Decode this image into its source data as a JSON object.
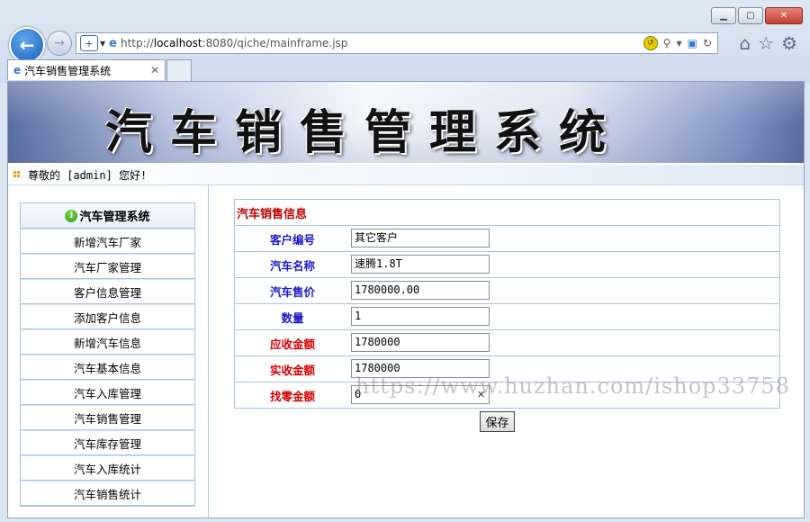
{
  "browser": {
    "url_prefix": "http://",
    "url_host": "localhost",
    "url_rest": ":8080/qiche/mainframe.jsp",
    "tab_title": "汽车销售管理系统"
  },
  "banner": {
    "title": "汽车销售管理系统"
  },
  "greeting": "尊敬的 [admin] 您好!",
  "sidebar": {
    "header": "汽车管理系统",
    "items": [
      {
        "label": "新增汽车厂家"
      },
      {
        "label": "汽车厂家管理"
      },
      {
        "label": "客户信息管理"
      },
      {
        "label": "添加客户信息"
      },
      {
        "label": "新增汽车信息"
      },
      {
        "label": "汽车基本信息"
      },
      {
        "label": "汽车入库管理"
      },
      {
        "label": "汽车销售管理"
      },
      {
        "label": "汽车库存管理"
      },
      {
        "label": "汽车入库统计"
      },
      {
        "label": "汽车销售统计"
      }
    ]
  },
  "form": {
    "title": "汽车销售信息",
    "fields": [
      {
        "label": "客户编号",
        "value": "其它客户"
      },
      {
        "label": "汽车名称",
        "value": "速腾1.8T"
      },
      {
        "label": "汽车售价",
        "value": "1780000.00"
      },
      {
        "label": "数量",
        "value": "1"
      },
      {
        "label": "应收金额",
        "value": "1780000"
      },
      {
        "label": "实收金额",
        "value": "1780000"
      },
      {
        "label": "找零金额",
        "value": "0"
      }
    ],
    "save_label": "保存"
  },
  "watermark": "https://www.huzhan.com/ishop33758",
  "colors": {
    "required_label": "#d40000",
    "label": "#1a1ac8",
    "form_title": "#c00000"
  }
}
